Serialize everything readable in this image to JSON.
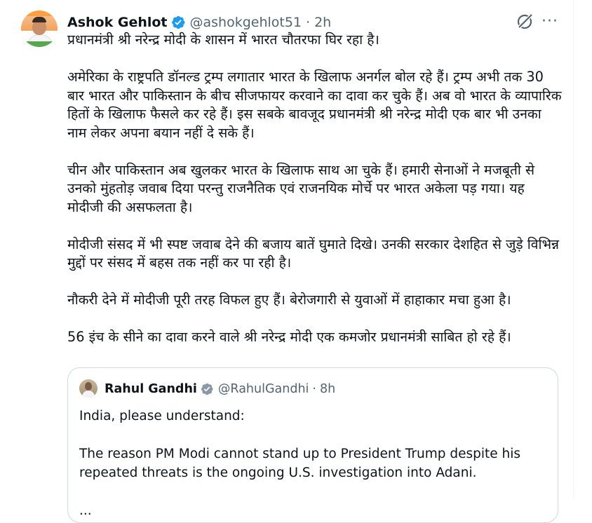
{
  "tweet": {
    "author_name": "Ashok Gehlot",
    "handle": "@ashokgehlot51",
    "separator": "·",
    "time": "2h",
    "more_label": "···",
    "paragraphs": [
      "प्रधानमंत्री श्री नरेन्द्र मोदी के शासन में भारत चौतरफा घिर रहा है।",
      "अमेरिका के राष्ट्रपति डॉनल्ड ट्रम्प लगातार भारत के खिलाफ अनर्गल बोल रहे हैं। ट्रम्प अभी तक 30 बार भारत और पाकिस्तान के बीच सीजफायर करवाने का दावा कर चुके हैं। अब वो भारत के व्यापारिक हितों के खिलाफ फैसले कर रहे हैं। इस सबके बावजूद प्रधानमंत्री श्री नरेन्द्र मोदी एक बार भी उनका नाम लेकर अपना बयान नहीं दे सके हैं।",
      "चीन और पाकिस्तान अब खुलकर भारत के खिलाफ साथ आ चुके हैं। हमारी सेनाओं ने मजबूती से उनको मुंहतोड़ जवाब दिया परन्तु राजनैतिक एवं राजनयिक मोर्चे पर भारत अकेला पड़ गया। यह मोदीजी की असफलता है।",
      "मोदीजी संसद में भी स्पष्ट जवाब देने की बजाय बातें घुमाते दिखे। उनकी सरकार देशहित से जुड़े विभिन्न मुद्दों पर संसद में बहस तक नहीं कर पा रही है।",
      "नौकरी देने में मोदीजी पूरी तरह विफल हुए हैं। बेरोजगारी से युवाओं में हाहाकार मचा हुआ है।",
      "56 इंच के सीने का दावा करने वाले श्री नरेन्द्र मोदी एक कमजोर प्रधानमंत्री साबित हो रहे हैं।"
    ]
  },
  "quoted": {
    "author_name": "Rahul Gandhi",
    "handle": "@RahulGandhi",
    "separator": "·",
    "time": "8h",
    "paragraphs": [
      "India, please understand:",
      "The reason PM Modi cannot stand up to President Trump despite his repeated threats is the ongoing U.S. investigation into Adani.",
      "..."
    ]
  },
  "colors": {
    "verified_blue": "#1d9bf0",
    "secondary_text": "#536471",
    "primary_text": "#0f1419",
    "border": "#cfd9de"
  },
  "icons": {
    "verified": "verified-badge-icon",
    "grok": "grok-icon",
    "more": "more-options-icon"
  }
}
